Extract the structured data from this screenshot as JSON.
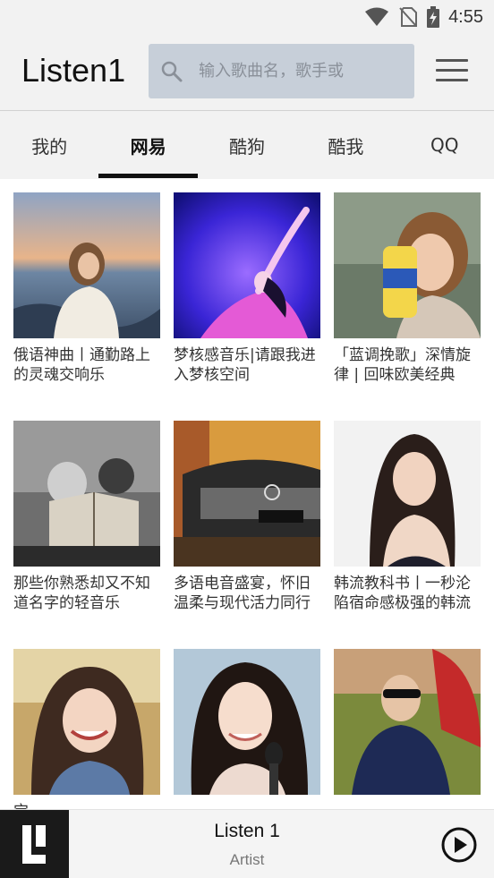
{
  "status": {
    "time": "4:55",
    "icons": [
      "wifi-icon",
      "no-sim-icon",
      "battery-charging-icon"
    ]
  },
  "header": {
    "title": "Listen1",
    "search_placeholder": "输入歌曲名，歌手或",
    "search_value": ""
  },
  "tabs": [
    {
      "label": "我的",
      "active": false
    },
    {
      "label": "网易",
      "active": true
    },
    {
      "label": "酷狗",
      "active": false
    },
    {
      "label": "酷我",
      "active": false
    },
    {
      "label": "QQ",
      "active": false
    }
  ],
  "playlists": [
    {
      "title": "俄语神曲丨通勤路上的灵魂交响乐",
      "cover": "beach-sunset-photo"
    },
    {
      "title": "梦核感音乐|请跟我进入梦核空间",
      "cover": "purple-dream-photo"
    },
    {
      "title": "「蓝调挽歌」深情旋律 | 回味欧美经典",
      "cover": "chips-portrait-photo"
    },
    {
      "title": "那些你熟悉却又不知道名字的轻音乐",
      "cover": "bw-book-cat-photo"
    },
    {
      "title": "多语电音盛宴，怀旧温柔与现代活力同行",
      "cover": "vintage-car-photo"
    },
    {
      "title": "韩流教科书丨一秒沦陷宿命感极强的韩流",
      "cover": "korean-portrait-photo"
    },
    {
      "title": "宝…",
      "cover": "smiling-girl-photo"
    },
    {
      "title": "",
      "cover": "microphone-portrait-photo"
    },
    {
      "title": "",
      "cover": "red-scarf-photo"
    }
  ],
  "player": {
    "title": "Listen 1",
    "artist": "Artist"
  },
  "colors": {
    "search_bg": "#c7cfd9",
    "tab_indicator": "#111111",
    "player_logo_bg": "#1a1a1a"
  }
}
